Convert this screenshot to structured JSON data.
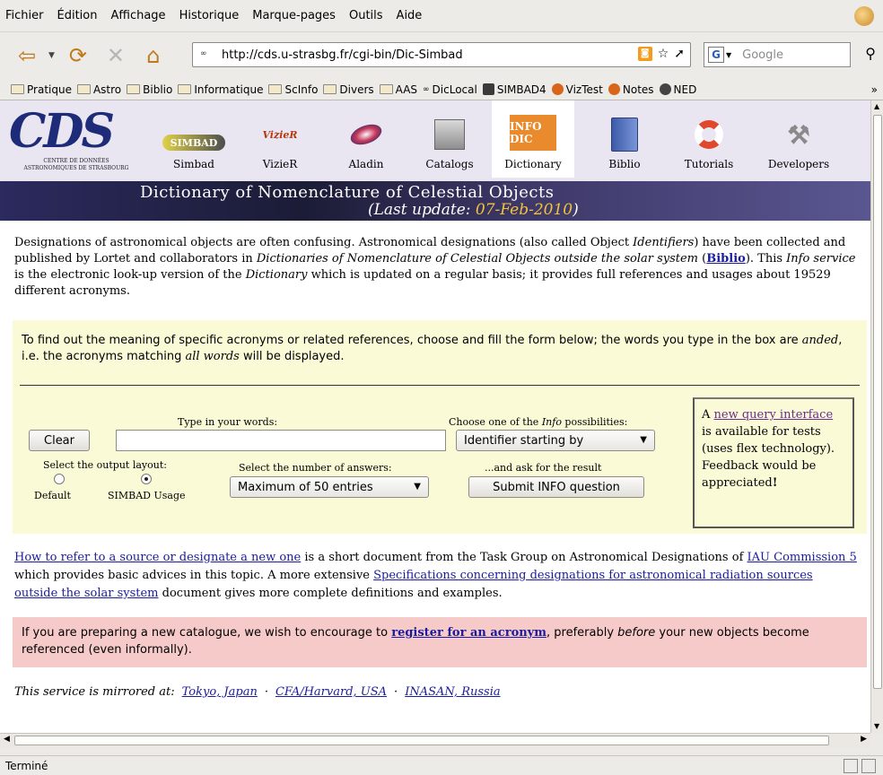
{
  "menubar": {
    "items": [
      "Fichier",
      "Édition",
      "Affichage",
      "Historique",
      "Marque-pages",
      "Outils",
      "Aide"
    ]
  },
  "navbar": {
    "url": "http://cds.u-strasbg.fr/cgi-bin/Dic-Simbad",
    "search_placeholder": "Google"
  },
  "bookmarks": {
    "items": [
      {
        "label": "Pratique",
        "icon": "folder-icon"
      },
      {
        "label": "Astro",
        "icon": "folder-icon"
      },
      {
        "label": "Biblio",
        "icon": "folder-icon"
      },
      {
        "label": "Informatique",
        "icon": "folder-icon"
      },
      {
        "label": "ScInfo",
        "icon": "folder-icon"
      },
      {
        "label": "Divers",
        "icon": "folder-icon"
      },
      {
        "label": "AAS",
        "icon": "folder-icon"
      },
      {
        "label": "DicLocal",
        "icon": "site-icon"
      },
      {
        "label": "SIMBAD4",
        "icon": "simbad-icon"
      },
      {
        "label": "VizTest",
        "icon": "vizier-icon"
      },
      {
        "label": "Notes",
        "icon": "vizier-icon"
      },
      {
        "label": "NED",
        "icon": "ned-icon"
      }
    ],
    "more": "»"
  },
  "cds_nav": {
    "logo_text": "CDS",
    "logo_sub1": "CENTRE DE DONNÉES",
    "logo_sub2": "ASTRONOMIQUES DE STRASBOURG",
    "items": [
      {
        "label": "Simbad",
        "badge": "SIMBAD"
      },
      {
        "label": "VizieR",
        "badge": "VizieR"
      },
      {
        "label": "Aladin",
        "badge": ""
      },
      {
        "label": "Catalogs",
        "badge": ""
      },
      {
        "label": "Dictionary",
        "badge": "INFO DIC"
      },
      {
        "label": "Biblio",
        "badge": ""
      },
      {
        "label": "Tutorials",
        "badge": ""
      },
      {
        "label": "Developers",
        "badge": ""
      }
    ]
  },
  "banner": {
    "title": "Dictionary of Nomenclature of Celestial Objects",
    "update_prefix": "(Last update: ",
    "update_date": "07-Feb-2010",
    "update_suffix": ")"
  },
  "intro": {
    "p1": "Designations of astronomical objects are often confusing. Astronomical designations (also called Object ",
    "identifiers": "Identifiers",
    "p2": ") have been collected and published by Lortet and collaborators in ",
    "dict_title": "Dictionaries of Nomenclature of Celestial Objects outside the solar system",
    "p3": " (",
    "biblio_link": "Biblio",
    "p4": "). This ",
    "info_service": "Info service",
    "p5": " is the electronic look-up version of the ",
    "dictionary": "Dictionary",
    "p6": " which is updated on a regular basis; it provides full references and usages about 19529 different acronyms."
  },
  "form": {
    "instructions_a": "To find out the meaning of specific acronyms or related references, choose and fill the form below; the words you type in the box are ",
    "anded": "anded",
    "instructions_b": ", i.e. the acronyms matching ",
    "all_words": "all words",
    "instructions_c": " will be displayed.",
    "type_label": "Type in your words:",
    "words_value": "",
    "choose_label_a": "Choose one of the ",
    "choose_label_info": "Info",
    "choose_label_b": " possibilities:",
    "choose_selected": "Identifier starting by",
    "clear_label": "Clear",
    "layout_label": "Select the output layout:",
    "layout_default": "Default",
    "layout_simbad": "SIMBAD Usage",
    "answers_label": "Select the number of answers:",
    "answers_selected": "Maximum of 50 entries",
    "ask_label": "...and ask for the result",
    "submit_label": "Submit INFO question",
    "note_a": "A ",
    "note_link": "new query interface",
    "note_b": " is available for tests (uses flex technology). Feedback would be appreciated",
    "note_c": "!"
  },
  "refer": {
    "link1": "How to refer to a source or designate a new one",
    "t1": " is a short document from the Task Group on Astronomical Designations of ",
    "link2": "IAU Commission 5",
    "t2": " which provides basic advices in this topic. A more extensive ",
    "link3": "Specifications concerning designations for astronomical radiation sources outside the solar system",
    "t3": " document gives more complete definitions and examples."
  },
  "pink": {
    "t1": "If you are preparing a new catalogue, we wish to encourage to ",
    "link": "register for an acronym",
    "t2": ", preferably ",
    "before": "before",
    "t3": " your new objects become referenced (even informally)."
  },
  "mirror": {
    "label": "This service is mirrored at:",
    "sites": [
      "Tokyo, Japan",
      "CFA/Harvard, USA",
      "INASAN, Russia"
    ],
    "sep": "·"
  },
  "status": {
    "text": "Terminé"
  }
}
